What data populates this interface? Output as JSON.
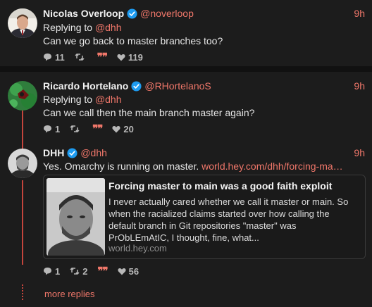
{
  "accent": "#f0776a",
  "posts": [
    {
      "author": "Nicolas Overloop",
      "handle": "@noverloop",
      "time": "9h",
      "replying_prefix": "Replying to ",
      "replying_handle": "@dhh",
      "text": "Can we go back to master branches too?",
      "stats": {
        "replies": "11",
        "reposts": "",
        "likes": "119"
      }
    },
    {
      "author": "Ricardo Hortelano",
      "handle": "@RHortelanoS",
      "time": "9h",
      "replying_prefix": "Replying to ",
      "replying_handle": "@dhh",
      "text": "Can we call then the main branch master again?",
      "stats": {
        "replies": "1",
        "reposts": "",
        "likes": "20"
      }
    },
    {
      "author": "DHH",
      "handle": "@dhh",
      "time": "9h",
      "text": "Yes. Omarchy is running on master. ",
      "link_text": "world.hey.com/dhh/forcing-ma…",
      "link_card": {
        "title": "Forcing master to main was a good faith exploit",
        "description": "I never actually cared whether we call it master or main. So when the racialized claims started over how calling the default branch in Git repositories \"master\" was PrObLEmAtIC, I thought, fine, what...",
        "domain": "world.hey.com"
      },
      "stats": {
        "replies": "1",
        "reposts": "2",
        "likes": "56"
      }
    }
  ],
  "quote_glyph": "❞❞",
  "more_replies": "more replies"
}
